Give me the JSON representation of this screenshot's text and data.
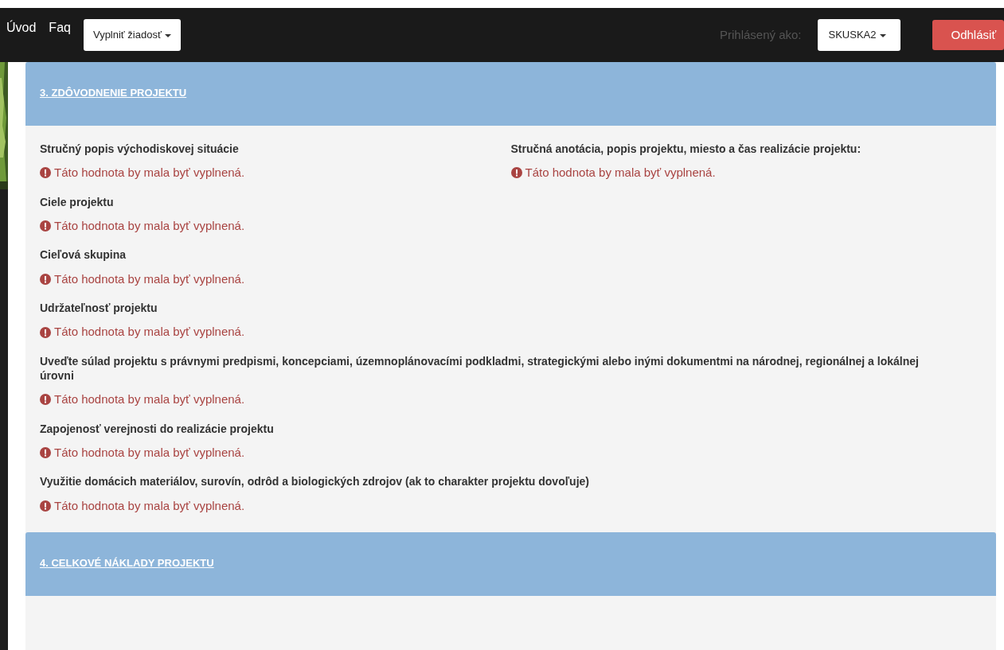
{
  "navbar": {
    "links": [
      "Úvod",
      "Faq"
    ],
    "dropdown": "Vyplniť žiadosť",
    "logged_label": "Prihlásený ako:",
    "user": "SKUSKA2",
    "logout": "Odhlásiť"
  },
  "sections": [
    {
      "title": "3. ZDÔVODNENIE PROJEKTU",
      "rows": [
        [
          {
            "label": "Stručný popis východiskovej situácie",
            "error": "Táto hodnota by mala byť vyplnená."
          },
          {
            "label": "Stručná anotácia, popis projektu, miesto a čas realizácie projektu:",
            "error": "Táto hodnota by mala byť vyplnená."
          }
        ],
        [
          {
            "label": "Ciele projektu",
            "error": "Táto hodnota by mala byť vyplnená."
          }
        ],
        [
          {
            "label": "Cieľová skupina",
            "error": "Táto hodnota by mala byť vyplnená."
          }
        ],
        [
          {
            "label": "Udržateľnosť projektu",
            "error": "Táto hodnota by mala byť vyplnená."
          }
        ],
        [
          {
            "label": "Uveďte súlad projektu s právnymi predpismi, koncepciami, územnoplánovacími podkladmi, strategickými alebo inými dokumentmi na národnej, regionálnej a lokálnej úrovni",
            "error": "Táto hodnota by mala byť vyplnená."
          }
        ],
        [
          {
            "label": "Zapojenosť verejnosti do realizácie projektu",
            "error": "Táto hodnota by mala byť vyplnená."
          }
        ],
        [
          {
            "label": "Využitie domácich materiálov, surovín, odrôd a biologických zdrojov (ak to charakter projektu dovoľuje)",
            "error": "Táto hodnota by mala byť vyplnená."
          }
        ]
      ]
    },
    {
      "title": "4. CELKOVÉ NÁKLADY PROJEKTU"
    }
  ]
}
